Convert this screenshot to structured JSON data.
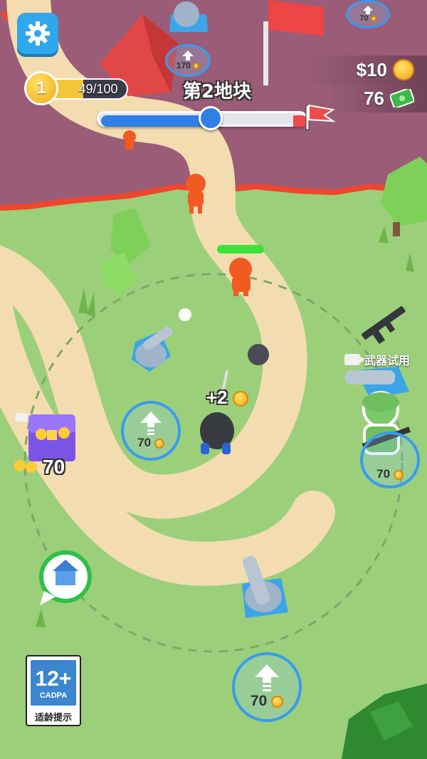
{
  "hud": {
    "level": "1",
    "xp_text": "49/100",
    "xp_fraction": 0.49,
    "stage_title": "第2地块",
    "stage_progress": 0.54,
    "cash": "$10",
    "gems": "76",
    "icons": [
      "gear-icon",
      "coin-icon",
      "cash-icon",
      "red-flag-icon"
    ]
  },
  "world": {
    "coin_popup": "+2",
    "weapon_trial_label": "武器试用",
    "chest_reward": "70",
    "upgrade_pads": [
      {
        "id": "left",
        "cost": "70"
      },
      {
        "id": "right",
        "cost": "70"
      },
      {
        "id": "bottom",
        "cost": "70"
      },
      {
        "id": "top-left",
        "cost": "170"
      },
      {
        "id": "top-right",
        "cost": "70"
      }
    ]
  },
  "age_rating": {
    "number": "12+",
    "org": "CADPA",
    "caption": "适龄提示"
  },
  "colors": {
    "grass": "#9ccf7a",
    "path": "#f3ddb0",
    "enemy_ground": "#9a5c77",
    "border_red": "#f0452f",
    "blue_ui": "#2f7fe6",
    "gold": "#f4b41b"
  }
}
